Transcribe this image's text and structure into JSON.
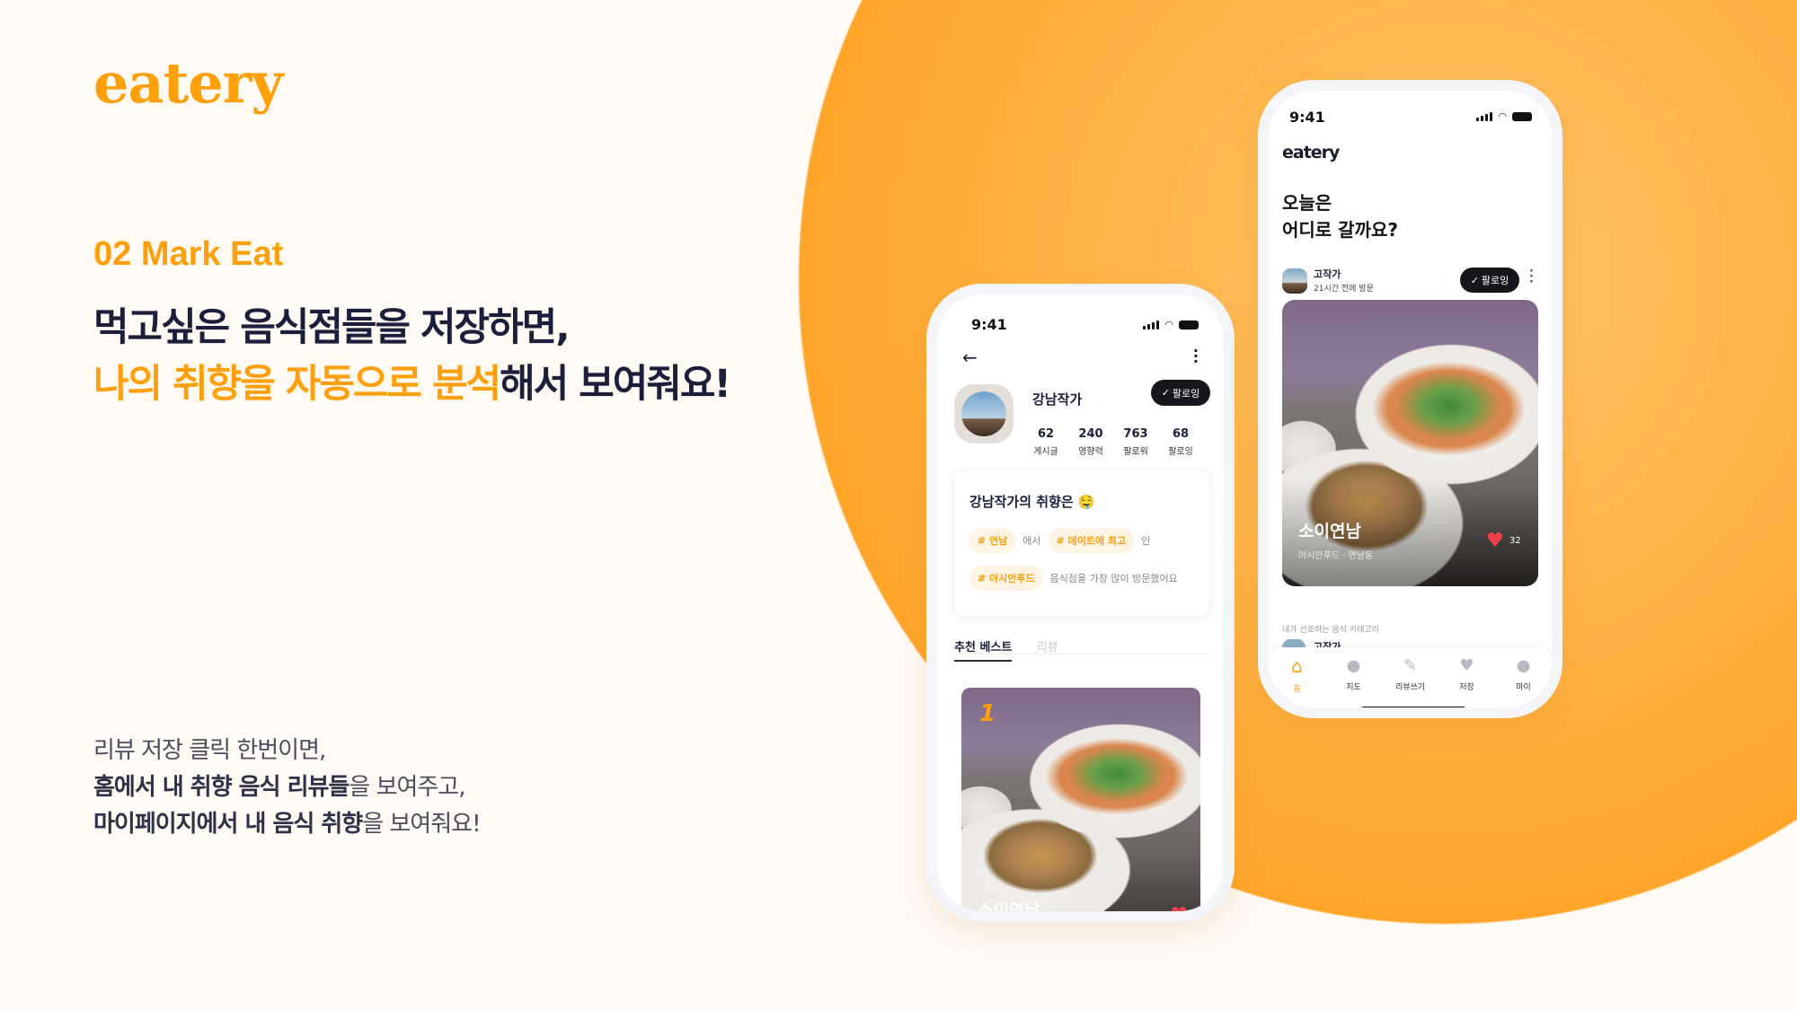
{
  "brand": {
    "logo": "eatery",
    "accent": "#FF9F0A"
  },
  "intro": {
    "section": "02 Mark Eat",
    "headline_line1": "먹고싶은 음식점들을 저장하면,",
    "headline_line2_accent": "나의 취향을 자동으로 분석",
    "headline_line2_rest": "해서 보여줘요!",
    "para_line1": "리뷰 저장 클릭 한번이면,",
    "para_line2_bold1": "홈에서 내 취향 음식 리뷰들",
    "para_line2_rest": "을 보여주고,",
    "para_line3_bold1": "마이페이지에서 내 음식 취향",
    "para_line3_rest": "을 보여줘요!"
  },
  "profile_phone": {
    "time": "9:41",
    "username": "강남작가",
    "follow_label": "팔로잉",
    "stats": [
      {
        "value": "62",
        "label": "게시글"
      },
      {
        "value": "240",
        "label": "영향력"
      },
      {
        "value": "763",
        "label": "팔로워"
      },
      {
        "value": "68",
        "label": "팔로잉"
      }
    ],
    "taste_title": "강남작가의 취향은 🤤",
    "tag1": "# 연남",
    "conn1": "에서",
    "tag2": "# 데이트에 최고",
    "conn2": "인",
    "tag3": "# 아시안푸드",
    "conn3": "음식점을 가장 많이 방문했어요",
    "tabs": [
      "추천 베스트",
      "리뷰"
    ],
    "best_rank": "1",
    "best_name": "소이연남"
  },
  "home_phone": {
    "time": "9:41",
    "logo": "eatery",
    "greeting_line1": "오늘은",
    "greeting_line2": "어디로 갈까요?",
    "post_user": "고작가",
    "post_time": "21시간 전에 방문",
    "follow_label": "팔로잉",
    "place_name": "소이연남",
    "place_meta": "아시안푸드 · 연남동",
    "likes": "32",
    "section_label": "내가 선호하는 음식 카테고리",
    "next_user": "고작가",
    "nav": [
      {
        "label": "홈",
        "icon": "home-icon"
      },
      {
        "label": "지도",
        "icon": "map-pin-icon"
      },
      {
        "label": "리뷰쓰기",
        "icon": "pencil-icon"
      },
      {
        "label": "저장",
        "icon": "heart-icon"
      },
      {
        "label": "마이",
        "icon": "user-icon"
      }
    ],
    "active_nav": "홈"
  }
}
